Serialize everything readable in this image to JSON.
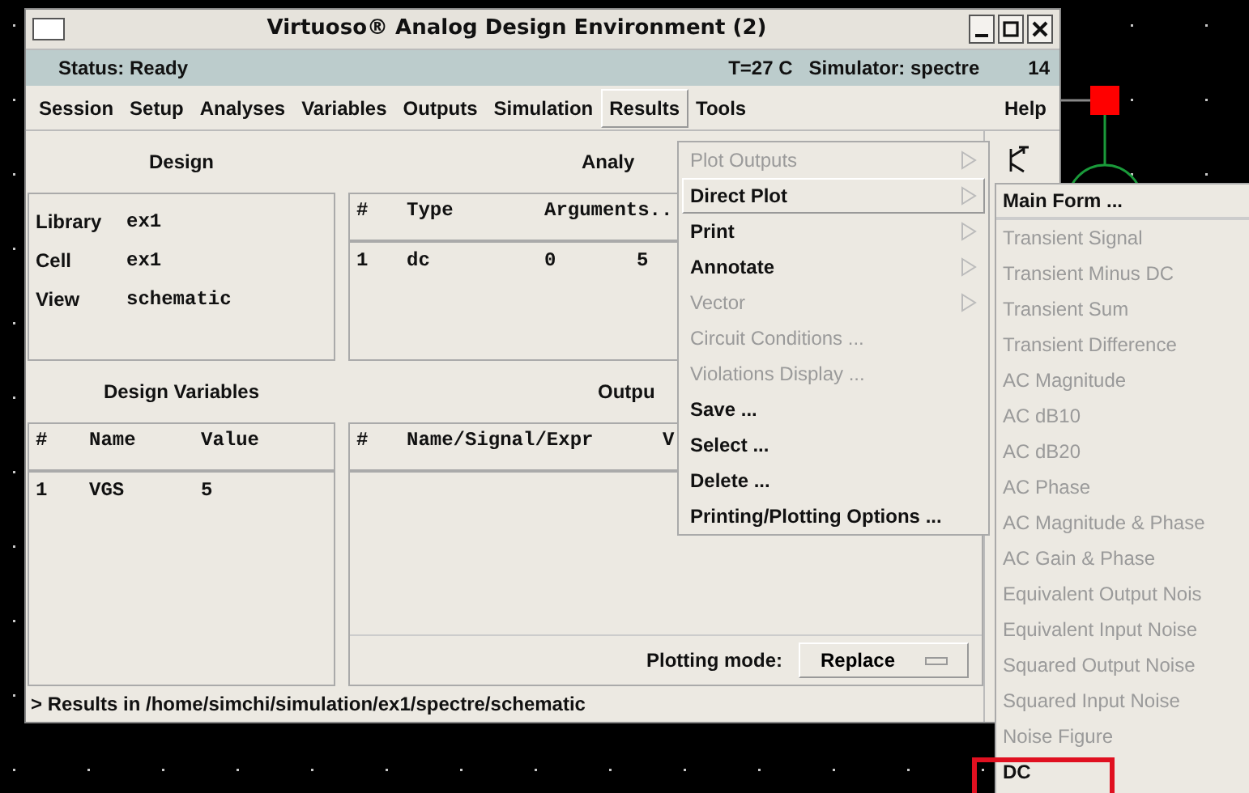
{
  "window": {
    "title": "Virtuoso® Analog Design Environment (2)"
  },
  "status": {
    "state": "Status: Ready",
    "temperature": "T=27 C",
    "simulator": "Simulator: spectre",
    "number": "14"
  },
  "menubar": [
    {
      "label": "Session",
      "selected": false
    },
    {
      "label": "Setup",
      "selected": false
    },
    {
      "label": "Analyses",
      "selected": false
    },
    {
      "label": "Variables",
      "selected": false
    },
    {
      "label": "Outputs",
      "selected": false
    },
    {
      "label": "Simulation",
      "selected": false
    },
    {
      "label": "Results",
      "selected": true
    },
    {
      "label": "Tools",
      "selected": false
    },
    {
      "label": "Help",
      "selected": false
    }
  ],
  "design": {
    "heading": "Design",
    "fields": [
      {
        "label": "Library",
        "value": "ex1"
      },
      {
        "label": "Cell",
        "value": "ex1"
      },
      {
        "label": "View",
        "value": "schematic"
      }
    ]
  },
  "analyses": {
    "heading": "Analy",
    "columns": [
      "#",
      "Type",
      "Arguments.."
    ],
    "rows": [
      [
        "1",
        "dc",
        "0",
        "5"
      ]
    ]
  },
  "design_variables": {
    "heading": "Design Variables",
    "columns": [
      "#",
      "Name",
      "Value"
    ],
    "rows": [
      [
        "1",
        "VGS",
        "5"
      ]
    ]
  },
  "outputs": {
    "heading": "Outpu",
    "columns": [
      "#",
      "Name/Signal/Expr",
      "V"
    ],
    "plotting_mode_label": "Plotting mode:",
    "plotting_mode": "Replace"
  },
  "message": "> Results in /home/simchi/simulation/ex1/spectre/schematic",
  "results_menu": [
    {
      "label": "Plot Outputs",
      "disabled": true,
      "submenu": true,
      "selected": false
    },
    {
      "label": "Direct Plot",
      "disabled": false,
      "submenu": true,
      "selected": true
    },
    {
      "label": "Print",
      "disabled": false,
      "submenu": true,
      "selected": false
    },
    {
      "label": "Annotate",
      "disabled": false,
      "submenu": true,
      "selected": false
    },
    {
      "label": "Vector",
      "disabled": true,
      "submenu": true,
      "selected": false
    },
    {
      "label": "Circuit Conditions ...",
      "disabled": true,
      "submenu": false,
      "selected": false
    },
    {
      "label": "Violations Display ...",
      "disabled": true,
      "submenu": false,
      "selected": false
    },
    {
      "label": "Save ...",
      "disabled": false,
      "submenu": false,
      "selected": false
    },
    {
      "label": "Select ...",
      "disabled": false,
      "submenu": false,
      "selected": false
    },
    {
      "label": "Delete ...",
      "disabled": false,
      "submenu": false,
      "selected": false
    },
    {
      "label": "Printing/Plotting Options ...",
      "disabled": false,
      "submenu": false,
      "selected": false
    }
  ],
  "direct_plot_menu": [
    {
      "label": "Main Form ...",
      "disabled": false,
      "highlighted": false
    },
    {
      "label": "Transient Signal",
      "disabled": true,
      "highlighted": false
    },
    {
      "label": "Transient Minus DC",
      "disabled": true,
      "highlighted": false
    },
    {
      "label": "Transient Sum",
      "disabled": true,
      "highlighted": false
    },
    {
      "label": "Transient Difference",
      "disabled": true,
      "highlighted": false
    },
    {
      "label": "AC Magnitude",
      "disabled": true,
      "highlighted": false
    },
    {
      "label": "AC dB10",
      "disabled": true,
      "highlighted": false
    },
    {
      "label": "AC dB20",
      "disabled": true,
      "highlighted": false
    },
    {
      "label": "AC Phase",
      "disabled": true,
      "highlighted": false
    },
    {
      "label": "AC Magnitude & Phase",
      "disabled": true,
      "highlighted": false
    },
    {
      "label": "AC Gain & Phase",
      "disabled": true,
      "highlighted": false
    },
    {
      "label": "Equivalent Output Nois",
      "disabled": true,
      "highlighted": false
    },
    {
      "label": "Equivalent Input Noise",
      "disabled": true,
      "highlighted": false
    },
    {
      "label": "Squared Output Noise",
      "disabled": true,
      "highlighted": false
    },
    {
      "label": "Squared Input Noise",
      "disabled": true,
      "highlighted": false
    },
    {
      "label": "Noise Figure",
      "disabled": true,
      "highlighted": false
    },
    {
      "label": "DC",
      "disabled": false,
      "highlighted": true
    }
  ]
}
